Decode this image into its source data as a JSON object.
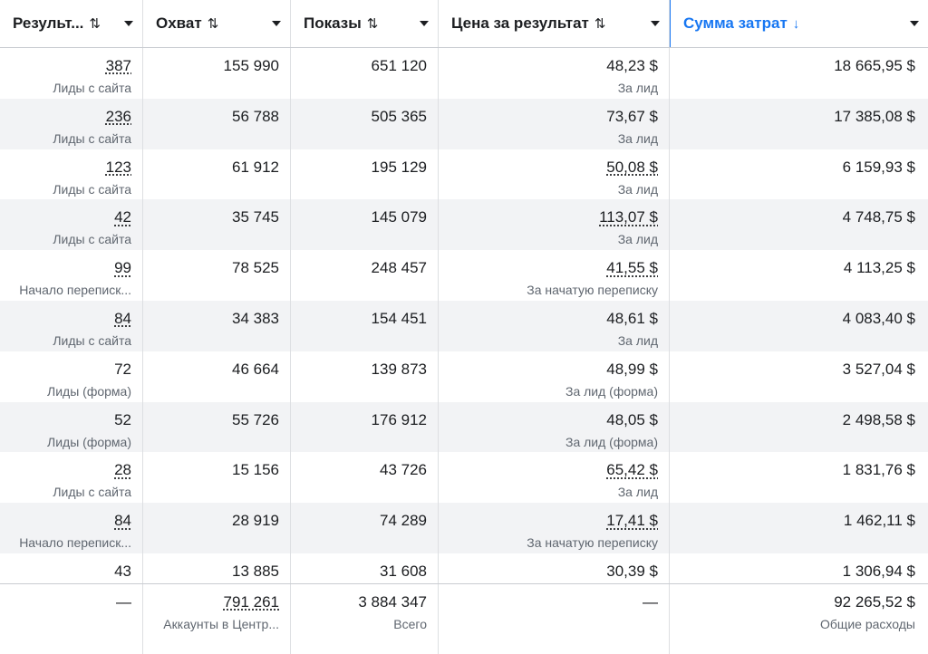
{
  "columns": [
    {
      "label": "Результ...",
      "sort": "⇅"
    },
    {
      "label": "Охват",
      "sort": "⇅"
    },
    {
      "label": "Показы",
      "sort": "⇅"
    },
    {
      "label": "Цена за результат",
      "sort": "⇅"
    },
    {
      "label": "Сумма затрат",
      "sort": "↓"
    }
  ],
  "accent_color": "#1877f2",
  "rows": [
    {
      "results": "387",
      "results_type": "Лиды с сайта",
      "reach": "155 990",
      "impressions": "651 120",
      "cpr": "48,23 $",
      "cpr_type": "За лид",
      "spend": "18 665,95 $"
    },
    {
      "results": "236",
      "results_type": "Лиды с сайта",
      "reach": "56 788",
      "impressions": "505 365",
      "cpr": "73,67 $",
      "cpr_type": "За лид",
      "spend": "17 385,08 $"
    },
    {
      "results": "123",
      "results_type": "Лиды с сайта",
      "reach": "61 912",
      "impressions": "195 129",
      "cpr": "50,08 $",
      "cpr_type": "За лид",
      "spend": "6 159,93 $"
    },
    {
      "results": "42",
      "results_type": "Лиды с сайта",
      "reach": "35 745",
      "impressions": "145 079",
      "cpr": "113,07 $",
      "cpr_type": "За лид",
      "spend": "4 748,75 $"
    },
    {
      "results": "99",
      "results_type": "Начало переписк...",
      "reach": "78 525",
      "impressions": "248 457",
      "cpr": "41,55 $",
      "cpr_type": "За начатую переписку",
      "spend": "4 113,25 $"
    },
    {
      "results": "84",
      "results_type": "Лиды с сайта",
      "reach": "34 383",
      "impressions": "154 451",
      "cpr": "48,61 $",
      "cpr_type": "За лид",
      "spend": "4 083,40 $"
    },
    {
      "results": "72",
      "results_type": "Лиды (форма)",
      "reach": "46 664",
      "impressions": "139 873",
      "cpr": "48,99 $",
      "cpr_type": "За лид (форма)",
      "spend": "3 527,04 $"
    },
    {
      "results": "52",
      "results_type": "Лиды (форма)",
      "reach": "55 726",
      "impressions": "176 912",
      "cpr": "48,05 $",
      "cpr_type": "За лид (форма)",
      "spend": "2 498,58 $"
    },
    {
      "results": "28",
      "results_type": "Лиды с сайта",
      "reach": "15 156",
      "impressions": "43 726",
      "cpr": "65,42 $",
      "cpr_type": "За лид",
      "spend": "1 831,76 $"
    },
    {
      "results": "84",
      "results_type": "Начало переписк...",
      "reach": "28 919",
      "impressions": "74 289",
      "cpr": "17,41 $",
      "cpr_type": "За начатую переписку",
      "spend": "1 462,11 $"
    },
    {
      "results": "43",
      "results_type": "",
      "reach": "13 885",
      "impressions": "31 608",
      "cpr": "30,39 $",
      "cpr_type": "",
      "spend": "1 306,94 $"
    }
  ],
  "totals": {
    "results": "—",
    "reach": "791 261",
    "reach_label": "Аккаунты в Центр...",
    "impressions": "3 884 347",
    "impressions_label": "Всего",
    "cpr": "—",
    "spend": "92 265,52 $",
    "spend_label": "Общие расходы"
  }
}
